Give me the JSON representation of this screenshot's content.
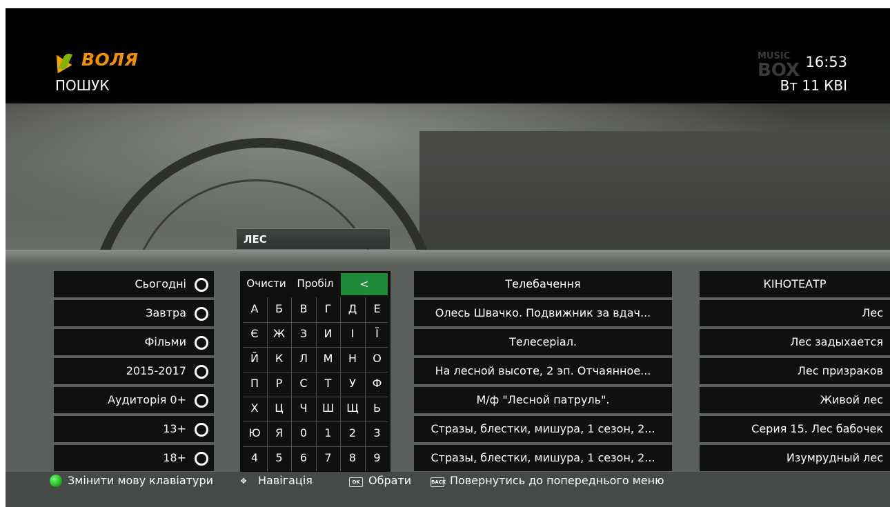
{
  "header": {
    "brand": "ВОЛЯ",
    "page_title": "ПОШУК",
    "channel_logo": {
      "line1": "MUSIC",
      "line2": "BOX"
    },
    "time": "16:53",
    "date": "Вт 11 КВІ"
  },
  "search": {
    "query": "ЛЕС"
  },
  "filters": [
    {
      "label": "Сьогодні"
    },
    {
      "label": "Завтра"
    },
    {
      "label": "Фільми"
    },
    {
      "label": "2015-2017"
    },
    {
      "label": "Аудиторія 0+"
    },
    {
      "label": "13+"
    },
    {
      "label": "18+"
    }
  ],
  "keyboard": {
    "clear_label": "Очисти",
    "space_label": "Пробіл",
    "backspace_label": "<",
    "rows": [
      [
        "А",
        "Б",
        "В",
        "Г",
        "Д",
        "Е"
      ],
      [
        "Є",
        "Ж",
        "З",
        "И",
        "І",
        "Ї"
      ],
      [
        "Й",
        "К",
        "Л",
        "М",
        "Н",
        "О"
      ],
      [
        "П",
        "Р",
        "С",
        "Т",
        "У",
        "Ф"
      ],
      [
        "Х",
        "Ц",
        "Ч",
        "Ш",
        "Щ",
        "Ь"
      ],
      [
        "Ю",
        "Я",
        "0",
        "1",
        "2",
        "3"
      ],
      [
        "4",
        "5",
        "6",
        "7",
        "8",
        "9"
      ]
    ]
  },
  "results_tv": {
    "header": "Телебачення",
    "items": [
      "Олесь Швачко. Подвижник за вдач...",
      "Телесеріал.",
      "На лесной высоте, 2 эп. Отчаянное...",
      "М/ф \"Лесной патруль\".",
      "Стразы, блестки, мишура, 1 сезон, 2...",
      "Стразы, блестки, мишура, 1 сезон, 2..."
    ]
  },
  "results_cinema": {
    "header": "КІНОТЕАТР",
    "items": [
      "Лес",
      "Лес задыхается",
      "Лес призраков",
      "Живой лес",
      "Серия 15. Лес бабочек",
      "Изумрудный лес"
    ]
  },
  "footer": {
    "change_keyboard": "Змінити мову клавіатури",
    "navigation": "Навігація",
    "ok_icon": "OK",
    "select": "Обрати",
    "back_icon": "BACK",
    "back_to_menu": "Повернутись до попереднього меню"
  },
  "colors": {
    "brand": "#f29100",
    "selected_key": "#1f8a3a",
    "panel": "#5b605c",
    "cell": "#101010"
  }
}
